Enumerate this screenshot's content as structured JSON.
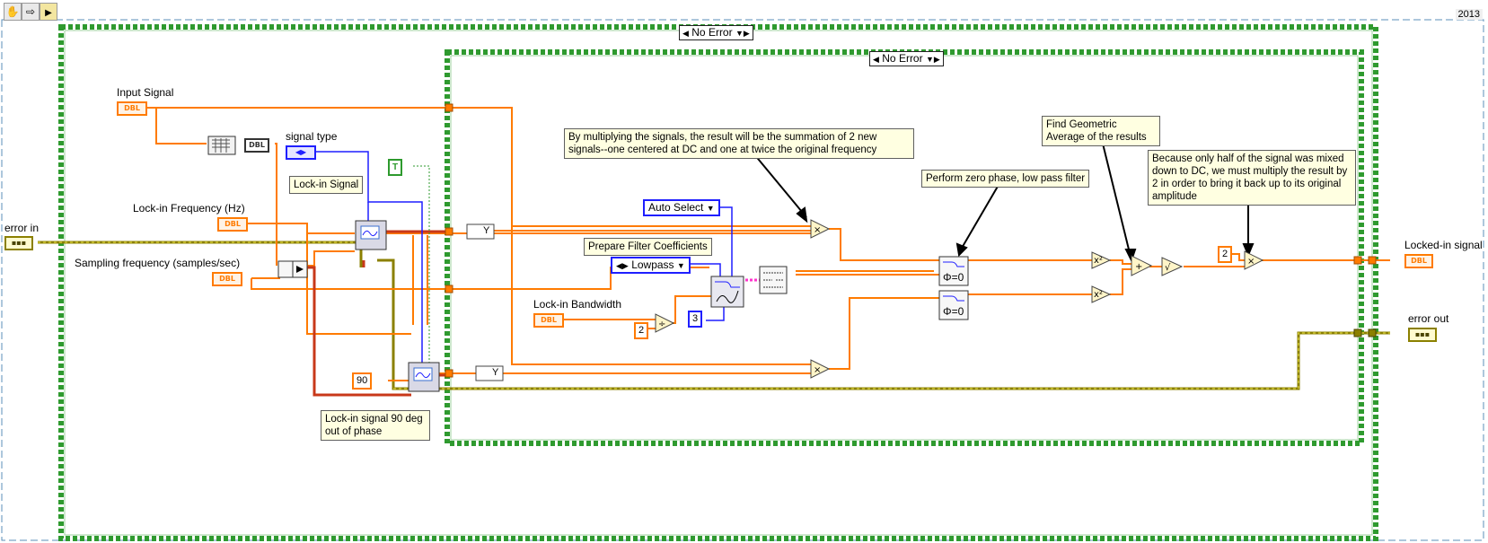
{
  "toolbar": {
    "icons": [
      "hand-icon",
      "step-arrow-icon",
      "labview-vi-icon"
    ],
    "version": "2013"
  },
  "cases": {
    "outer": "No Error",
    "inner": "No Error"
  },
  "labels": {
    "input_signal": "Input Signal",
    "lock_in_frequency": "Lock-in Frequency (Hz)",
    "sampling_frequency": "Sampling frequency (samples/sec)",
    "signal_type": "signal type",
    "lock_in_bandwidth": "Lock-in Bandwidth",
    "error_in": "error in",
    "error_out": "error out",
    "locked_in_signal": "Locked-in signal"
  },
  "notes": {
    "lock_in_signal": "Lock-in Signal",
    "lock_in_90": "Lock-in signal 90 deg out of phase",
    "multiply": "By multiplying the signals, the result will be the summation of 2 new signals--one centered at DC and one at twice the original frequency",
    "prepare_filter": "Prepare Filter Coefficients",
    "zero_phase": "Perform zero phase, low pass filter",
    "geometric": "Find Geometric Average of the results",
    "only_half": "Because only half of the signal was mixed down to DC, we must multiply the result by 2 in order to bring it back up to its original amplitude"
  },
  "constants": {
    "auto_select": "Auto Select",
    "lowpass": "Lowpass",
    "two_a": "2",
    "three": "3",
    "ninety": "90",
    "two_b": "2",
    "true_const": "T"
  },
  "terminals": {
    "dbl": "DBL",
    "error_cluster": "▪▪▪",
    "phi_zero": "Φ=0",
    "y": "Y"
  },
  "colors": {
    "orange_wire": "#ff7b00",
    "error_wire": "#8b8000",
    "blue_wire": "#1f1fff",
    "case_border": "#2f9a2f",
    "pink_wire": "#ff33cc"
  }
}
